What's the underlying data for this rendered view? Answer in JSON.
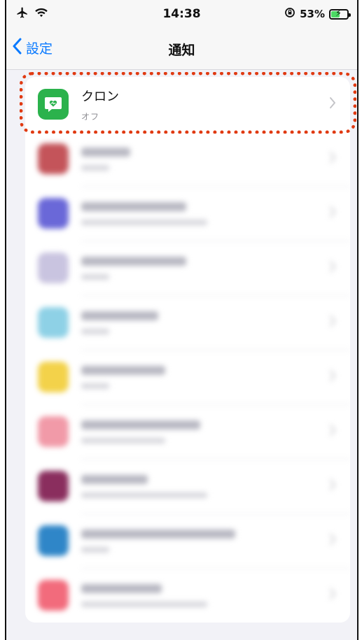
{
  "status_bar": {
    "time": "14:38",
    "battery_text": "53%",
    "battery_level": 0.53,
    "icons": [
      "airplane-icon",
      "wifi-icon",
      "rotation-lock-icon",
      "battery-icon"
    ]
  },
  "nav": {
    "back_label": "設定",
    "title": "通知"
  },
  "highlighted_app": {
    "name": "クロン",
    "subtitle": "オフ",
    "icon": "heart-chat-icon",
    "icon_color": "#2bb24c"
  },
  "blurred_apps": [
    {
      "icon_color": "#c4545a"
    },
    {
      "icon_color": "#6a68d8"
    },
    {
      "icon_color": "#c9c4e0"
    },
    {
      "icon_color": "#8ed1e6"
    },
    {
      "icon_color": "#f3d24a"
    },
    {
      "icon_color": "#f19aa8"
    },
    {
      "icon_color": "#8a2e5e"
    },
    {
      "icon_color": "#2f86c8"
    },
    {
      "icon_color": "#f26b7c"
    }
  ],
  "colors": {
    "accent": "#0a7aff",
    "highlight": "#e03a12"
  }
}
